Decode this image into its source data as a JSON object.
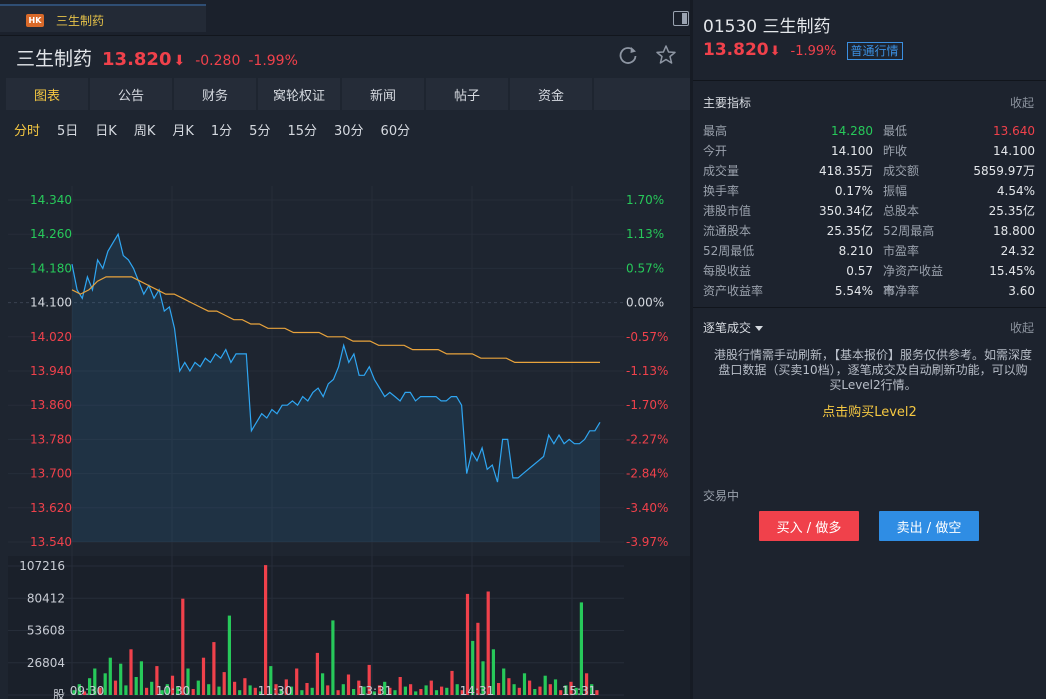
{
  "tab": {
    "badge": "HK",
    "label": "三生制药"
  },
  "header": {
    "name": "三生制药",
    "price": "13.820",
    "arrow": "⬇",
    "change": "-0.280",
    "percent": "-1.99%"
  },
  "nav": [
    "图表",
    "公告",
    "财务",
    "窝轮权证",
    "新闻",
    "帖子",
    "资金"
  ],
  "periods": [
    "分时",
    "5日",
    "日K",
    "周K",
    "月K",
    "1分",
    "5分",
    "15分",
    "30分",
    "60分"
  ],
  "side": {
    "title": "01530 三生制药",
    "price": "13.820",
    "arrow": "⬇",
    "percent": "-1.99%",
    "quote_tag": "普通行情",
    "metrics_title": "主要指标",
    "collapse": "收起",
    "metrics": [
      [
        "最高",
        "14.280",
        "最低",
        "13.640"
      ],
      [
        "今开",
        "14.100",
        "昨收",
        "14.100"
      ],
      [
        "成交量",
        "418.35万",
        "成交额",
        "5859.97万"
      ],
      [
        "换手率",
        "0.17%",
        "振幅",
        "4.54%"
      ],
      [
        "港股市值",
        "350.34亿",
        "总股本",
        "25.35亿"
      ],
      [
        "流通股本",
        "25.35亿",
        "52周最高",
        "18.800"
      ],
      [
        "52周最低",
        "8.210",
        "市盈率",
        "24.32"
      ],
      [
        "每股收益",
        "0.57",
        "净资产收益率",
        "15.45%"
      ],
      [
        "资产收益率",
        "5.54%",
        "市净率",
        "3.60"
      ]
    ],
    "ticks_title": "逐笔成交",
    "notice": "港股行情需手动刷新，【基本报价】服务仅供参考。如需深度盘口数据（买卖10档），逐笔成交及自动刷新功能，可以购买Level2行情。",
    "buy_level2": "点击购买Level2",
    "trading_status": "交易中",
    "buy_button": "买入 / 做多",
    "sell_button": "卖出 / 做空"
  },
  "chart_data": {
    "type": "line",
    "price_ticks": [
      "14.340",
      "14.260",
      "14.180",
      "14.100",
      "14.020",
      "13.940",
      "13.860",
      "13.780",
      "13.700",
      "13.620",
      "13.540"
    ],
    "price_tick_values": [
      14.34,
      14.26,
      14.18,
      14.1,
      14.02,
      13.94,
      13.86,
      13.78,
      13.7,
      13.62,
      13.54
    ],
    "pct_ticks": [
      "1.70%",
      "1.13%",
      "0.57%",
      "0.00%",
      "-0.57%",
      "-1.13%",
      "-1.70%",
      "-2.27%",
      "-2.84%",
      "-3.40%",
      "-3.97%"
    ],
    "volume_ticks": [
      "107216",
      "80412",
      "53608",
      "26804",
      "股"
    ],
    "volume_tick_values": [
      107216,
      80412,
      53608,
      26804,
      0
    ],
    "time_ticks": [
      "09:30",
      "10:30",
      "11:30",
      "13:31",
      "14:31",
      "15:31"
    ],
    "ylim": [
      13.54,
      14.34
    ],
    "prev_close": 14.1,
    "colors": {
      "price": "#2fa6f2",
      "avg": "#e8a33c",
      "up": "#27c95a",
      "down": "#f0414b",
      "up_text": "#27c95a",
      "down_text": "#f0414b"
    },
    "series": [
      {
        "name": "price",
        "values": [
          14.19,
          14.13,
          14.11,
          14.16,
          14.13,
          14.2,
          14.18,
          14.22,
          14.24,
          14.26,
          14.21,
          14.2,
          14.18,
          14.15,
          14.12,
          14.14,
          14.11,
          14.13,
          14.08,
          14.09,
          14.04,
          13.94,
          13.96,
          13.94,
          13.96,
          13.95,
          13.97,
          13.96,
          13.98,
          13.97,
          13.99,
          13.96,
          13.98,
          13.98,
          13.98,
          13.8,
          13.82,
          13.84,
          13.83,
          13.85,
          13.84,
          13.86,
          13.86,
          13.87,
          13.86,
          13.88,
          13.87,
          13.89,
          13.9,
          13.88,
          13.91,
          13.92,
          13.95,
          14.0,
          13.96,
          13.98,
          13.93,
          13.93,
          13.95,
          13.92,
          13.9,
          13.88,
          13.89,
          13.88,
          13.87,
          13.89,
          13.89,
          13.87,
          13.88,
          13.88,
          13.88,
          13.88,
          13.87,
          13.87,
          13.88,
          13.88,
          13.86,
          13.7,
          13.75,
          13.73,
          13.76,
          13.71,
          13.72,
          13.68,
          13.78,
          13.78,
          13.69,
          13.69,
          13.7,
          13.71,
          13.72,
          13.73,
          13.74,
          13.79,
          13.77,
          13.79,
          13.77,
          13.78,
          13.77,
          13.77,
          13.78,
          13.8,
          13.8,
          13.82
        ]
      },
      {
        "name": "avg",
        "values": [
          14.13,
          14.12,
          14.13,
          14.15,
          14.16,
          14.16,
          14.16,
          14.16,
          14.15,
          14.14,
          14.13,
          14.12,
          14.12,
          14.11,
          14.1,
          14.09,
          14.08,
          14.08,
          14.07,
          14.06,
          14.06,
          14.05,
          14.05,
          14.04,
          14.04,
          14.04,
          14.03,
          14.03,
          14.03,
          14.03,
          14.02,
          14.02,
          14.02,
          14.01,
          14.01,
          14.01,
          14.0,
          14.0,
          14.0,
          14.0,
          13.99,
          13.99,
          13.99,
          13.99,
          13.98,
          13.98,
          13.98,
          13.98,
          13.97,
          13.97,
          13.97,
          13.97,
          13.96,
          13.96,
          13.96,
          13.96,
          13.96,
          13.96,
          13.96,
          13.96,
          13.96,
          13.96,
          13.96
        ]
      }
    ],
    "volumes": [
      [
        4000,
        1
      ],
      [
        9000,
        1
      ],
      [
        3000,
        0
      ],
      [
        14000,
        1
      ],
      [
        22000,
        1
      ],
      [
        6000,
        0
      ],
      [
        18000,
        1
      ],
      [
        31000,
        1
      ],
      [
        12000,
        0
      ],
      [
        26000,
        1
      ],
      [
        8000,
        1
      ],
      [
        38000,
        0
      ],
      [
        15000,
        1
      ],
      [
        28000,
        1
      ],
      [
        6000,
        0
      ],
      [
        11000,
        1
      ],
      [
        24000,
        0
      ],
      [
        4000,
        1
      ],
      [
        9000,
        1
      ],
      [
        16000,
        0
      ],
      [
        7000,
        1
      ],
      [
        80000,
        0
      ],
      [
        22000,
        1
      ],
      [
        5000,
        0
      ],
      [
        12000,
        1
      ],
      [
        31000,
        0
      ],
      [
        9000,
        1
      ],
      [
        44000,
        0
      ],
      [
        7000,
        1
      ],
      [
        19000,
        0
      ],
      [
        66000,
        1
      ],
      [
        11000,
        0
      ],
      [
        4000,
        1
      ],
      [
        14000,
        0
      ],
      [
        8000,
        1
      ],
      [
        6000,
        0
      ],
      [
        3000,
        1
      ],
      [
        108000,
        0
      ],
      [
        24000,
        1
      ],
      [
        9000,
        0
      ],
      [
        5000,
        1
      ],
      [
        13000,
        0
      ],
      [
        7000,
        1
      ],
      [
        22000,
        0
      ],
      [
        4000,
        1
      ],
      [
        10000,
        0
      ],
      [
        6000,
        1
      ],
      [
        35000,
        0
      ],
      [
        18000,
        1
      ],
      [
        8000,
        0
      ],
      [
        62000,
        1
      ],
      [
        4000,
        0
      ],
      [
        9000,
        1
      ],
      [
        17000,
        0
      ],
      [
        5000,
        1
      ],
      [
        12000,
        0
      ],
      [
        7000,
        1
      ],
      [
        25000,
        0
      ],
      [
        3000,
        1
      ],
      [
        8000,
        0
      ],
      [
        11000,
        1
      ],
      [
        6000,
        0
      ],
      [
        4000,
        1
      ],
      [
        15000,
        0
      ],
      [
        7000,
        1
      ],
      [
        9000,
        0
      ],
      [
        3000,
        1
      ],
      [
        5000,
        0
      ],
      [
        8000,
        1
      ],
      [
        12000,
        0
      ],
      [
        4000,
        1
      ],
      [
        7000,
        0
      ],
      [
        6000,
        1
      ],
      [
        20000,
        0
      ],
      [
        9000,
        1
      ],
      [
        4000,
        0
      ],
      [
        84000,
        0
      ],
      [
        45000,
        1
      ],
      [
        60000,
        0
      ],
      [
        28000,
        1
      ],
      [
        86000,
        0
      ],
      [
        38000,
        1
      ],
      [
        10000,
        0
      ],
      [
        22000,
        1
      ],
      [
        14000,
        0
      ],
      [
        9000,
        1
      ],
      [
        6000,
        0
      ],
      [
        18000,
        1
      ],
      [
        12000,
        0
      ],
      [
        5000,
        1
      ],
      [
        7000,
        0
      ],
      [
        16000,
        1
      ],
      [
        9000,
        0
      ],
      [
        13000,
        1
      ],
      [
        4000,
        0
      ],
      [
        8000,
        1
      ],
      [
        11000,
        0
      ],
      [
        6000,
        1
      ],
      [
        77000,
        1
      ],
      [
        18000,
        0
      ],
      [
        9000,
        1
      ],
      [
        4000,
        0
      ]
    ]
  }
}
